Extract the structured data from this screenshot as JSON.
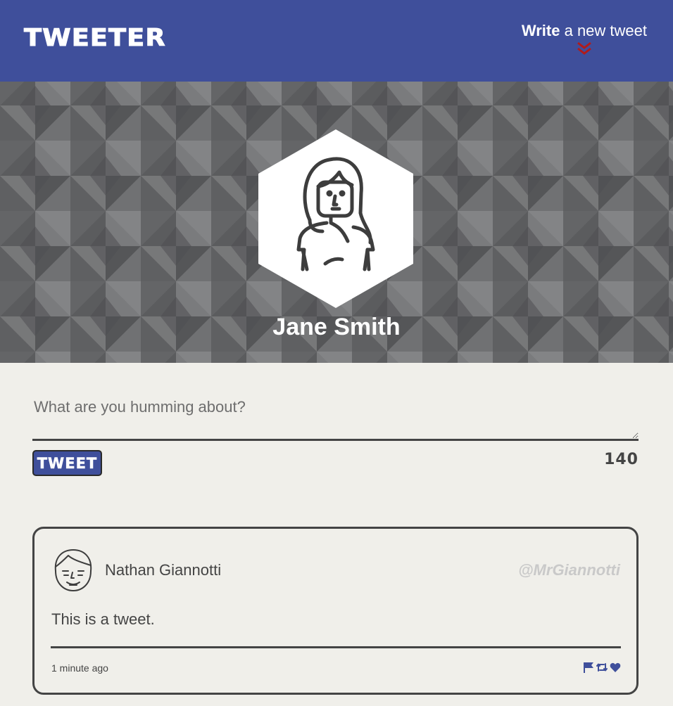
{
  "nav": {
    "logo": "TWEETER",
    "compose_strong": "Write",
    "compose_rest": " a new tweet",
    "arrow_icon": "chevron-double-down-icon",
    "arrow_color": "#b11b1b"
  },
  "profile": {
    "name": "Jane Smith"
  },
  "compose": {
    "placeholder": "What are you humming about?",
    "button_label": "TWEET",
    "counter": "140"
  },
  "tweet": {
    "author": "Nathan Giannotti",
    "handle": "@MrGiannotti",
    "body": "This is a tweet.",
    "timestamp": "1 minute ago",
    "actions": [
      "flag-icon",
      "retweet-icon",
      "heart-icon"
    ]
  },
  "colors": {
    "brand": "#3f4f9b",
    "background": "#f0efea",
    "accent": "#b11b1b"
  }
}
